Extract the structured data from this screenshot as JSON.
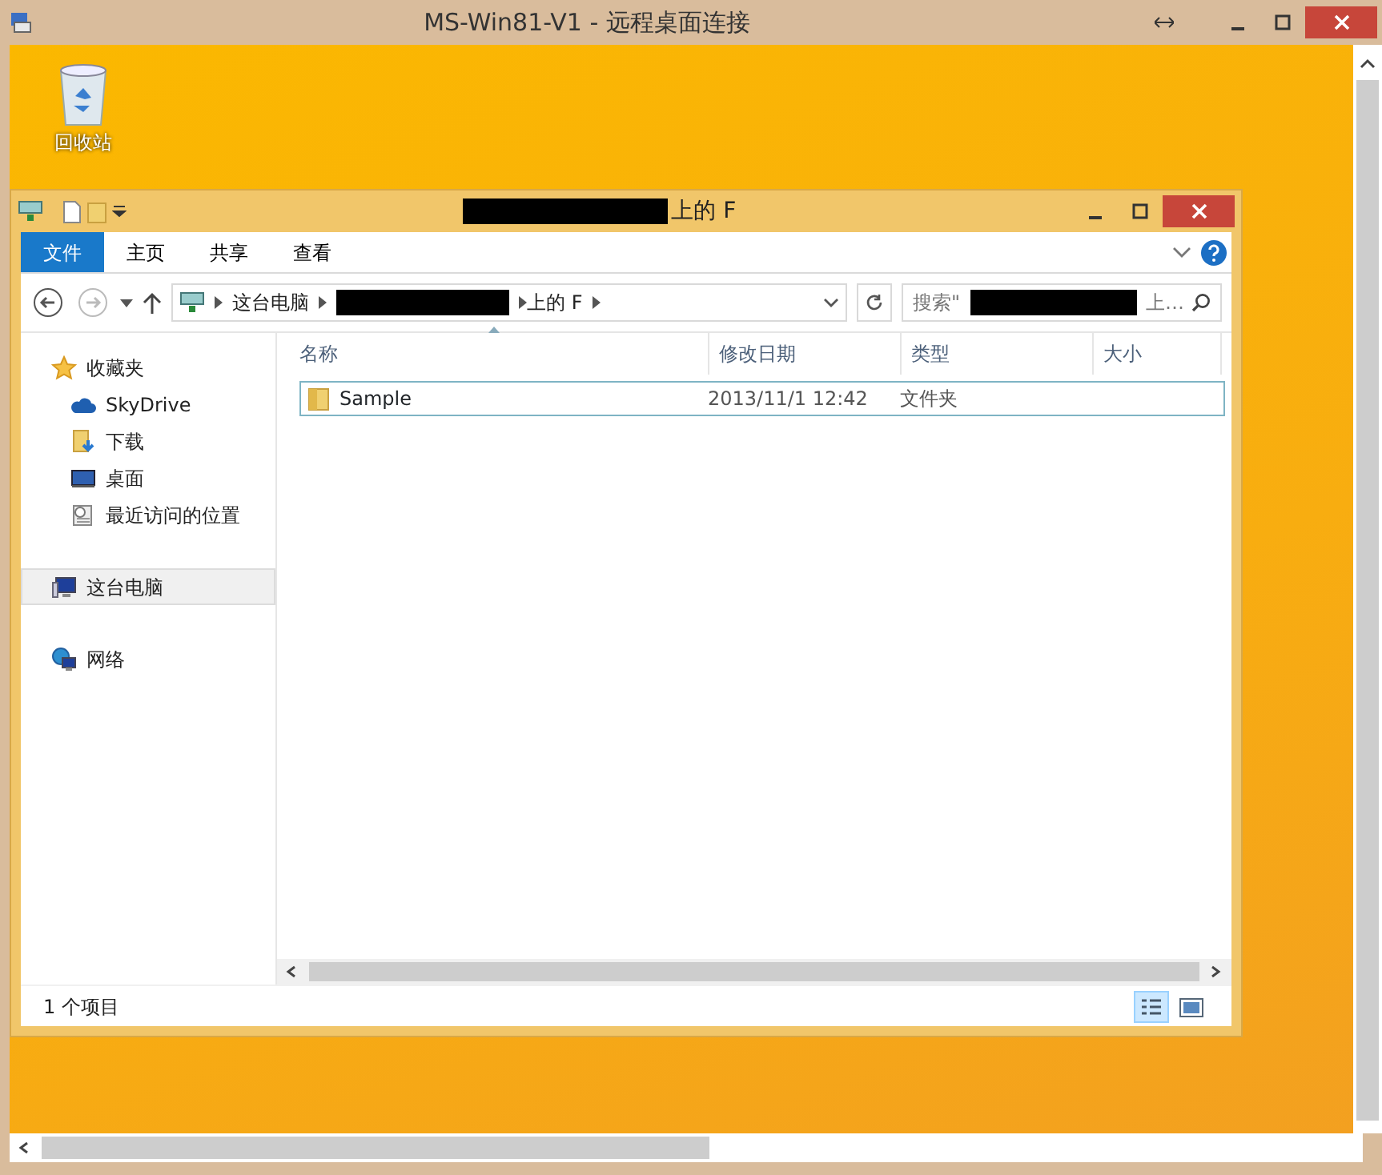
{
  "window": {
    "title": "MS-Win81-V1 - 远程桌面连接"
  },
  "desktop": {
    "icons": [
      {
        "label": "回收站"
      }
    ]
  },
  "explorer": {
    "title": [
      {
        "kind": "redacted"
      },
      {
        "kind": "text",
        "text": "上的 F"
      }
    ],
    "ribbon_tabs": [
      {
        "label": "文件",
        "kind": "file"
      },
      {
        "label": "主页",
        "kind": "tab"
      },
      {
        "label": "共享",
        "kind": "tab"
      },
      {
        "label": "查看",
        "kind": "tab"
      }
    ],
    "address": [
      {
        "kind": "text",
        "text": "这台电脑"
      },
      {
        "kind": "redacted"
      },
      {
        "kind": "text",
        "text": "上的 F"
      }
    ],
    "search": [
      {
        "kind": "text",
        "text": "搜索\""
      },
      {
        "kind": "redacted"
      },
      {
        "kind": "text",
        "text": "上…"
      }
    ],
    "nav": [
      {
        "label": "收藏夹",
        "kind": "favorites",
        "selected": false,
        "children": [
          {
            "label": "SkyDrive",
            "kind": "cloud",
            "selected": false
          },
          {
            "label": "下载",
            "kind": "downloads",
            "selected": false
          },
          {
            "label": "桌面",
            "kind": "desktop",
            "selected": false
          },
          {
            "label": "最近访问的位置",
            "kind": "recent",
            "selected": false
          }
        ]
      },
      {
        "label": "这台电脑",
        "kind": "computer",
        "selected": true
      },
      {
        "label": "网络",
        "kind": "network",
        "selected": false
      }
    ],
    "columns": [
      {
        "label": "名称",
        "sorted": true
      },
      {
        "label": "修改日期",
        "sorted": false
      },
      {
        "label": "类型",
        "sorted": false
      },
      {
        "label": "大小",
        "sorted": false
      }
    ],
    "rows": [
      {
        "name": "Sample",
        "date": "2013/11/1 12:42",
        "type": "文件夹",
        "selected": true
      }
    ],
    "status_bar": "1 个项目",
    "views": [
      {
        "kind": "details",
        "selected": true
      },
      {
        "kind": "thumbnails",
        "selected": false
      }
    ]
  }
}
